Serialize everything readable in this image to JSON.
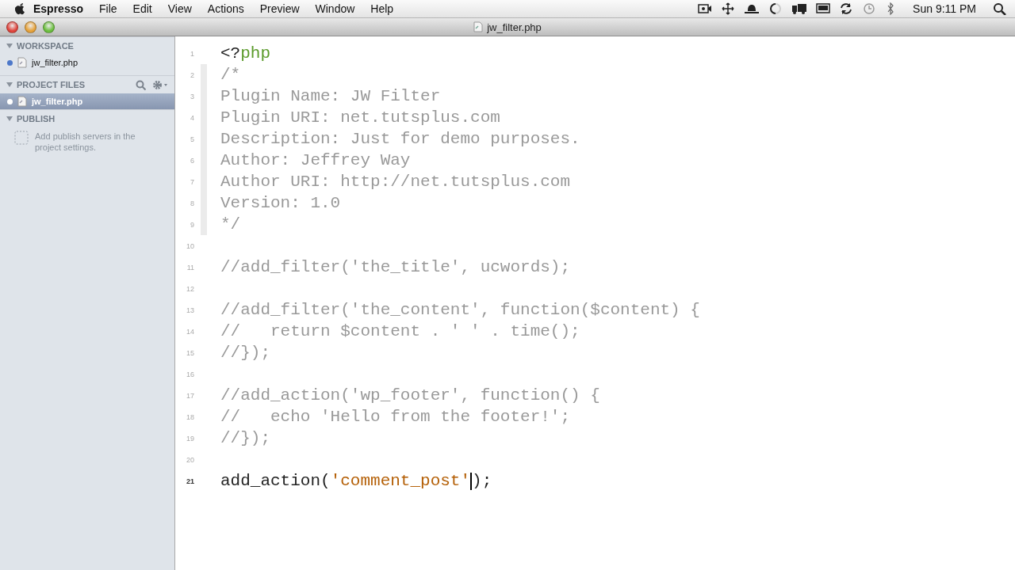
{
  "menu_bar": {
    "app_name": "Espresso",
    "menus": [
      "File",
      "Edit",
      "View",
      "Actions",
      "Preview",
      "Window",
      "Help"
    ],
    "clock": "Sun 9:11 PM"
  },
  "window": {
    "title": "jw_filter.php"
  },
  "sidebar": {
    "sections": [
      {
        "title": "WORKSPACE",
        "expanded": true,
        "items": [
          {
            "label": "jw_filter.php",
            "selected": false
          }
        ]
      },
      {
        "title": "PROJECT FILES",
        "expanded": true,
        "tools": true,
        "items": [
          {
            "label": "jw_filter.php",
            "selected": true
          }
        ]
      },
      {
        "title": "PUBLISH",
        "expanded": true,
        "hint": "Add publish servers in the project settings."
      }
    ]
  },
  "editor": {
    "lines": [
      {
        "number": "1",
        "current": false,
        "tokens": [
          {
            "text": "<?",
            "kind": "plain"
          },
          {
            "text": "php",
            "kind": "keyword"
          }
        ]
      },
      {
        "number": "2",
        "current": false,
        "tokens": [
          {
            "text": "/*",
            "kind": "comment"
          }
        ]
      },
      {
        "number": "3",
        "current": false,
        "tokens": [
          {
            "text": "Plugin Name: JW Filter",
            "kind": "comment"
          }
        ]
      },
      {
        "number": "4",
        "current": false,
        "tokens": [
          {
            "text": "Plugin URI: net.tutsplus.com",
            "kind": "comment"
          }
        ]
      },
      {
        "number": "5",
        "current": false,
        "tokens": [
          {
            "text": "Description: Just for demo purposes.",
            "kind": "comment"
          }
        ]
      },
      {
        "number": "6",
        "current": false,
        "tokens": [
          {
            "text": "Author: Jeffrey Way",
            "kind": "comment"
          }
        ]
      },
      {
        "number": "7",
        "current": false,
        "tokens": [
          {
            "text": "Author URI: http://net.tutsplus.com",
            "kind": "comment"
          }
        ]
      },
      {
        "number": "8",
        "current": false,
        "tokens": [
          {
            "text": "Version: 1.0",
            "kind": "comment"
          }
        ]
      },
      {
        "number": "9",
        "current": false,
        "tokens": [
          {
            "text": "*/",
            "kind": "comment"
          }
        ]
      },
      {
        "number": "10",
        "current": false
      },
      {
        "number": "11",
        "current": false,
        "tokens": [
          {
            "text": "//add_filter('the_title', ucwords);",
            "kind": "comment"
          }
        ]
      },
      {
        "number": "12",
        "current": false
      },
      {
        "number": "13",
        "current": false,
        "tokens": [
          {
            "text": "//add_filter('the_content', function($content) {",
            "kind": "comment"
          }
        ]
      },
      {
        "number": "14",
        "current": false,
        "tokens": [
          {
            "text": "//   return $content . ' ' . time();",
            "kind": "comment"
          }
        ]
      },
      {
        "number": "15",
        "current": false,
        "tokens": [
          {
            "text": "//});",
            "kind": "comment"
          }
        ]
      },
      {
        "number": "16",
        "current": false
      },
      {
        "number": "17",
        "current": false,
        "tokens": [
          {
            "text": "//add_action('wp_footer', function() {",
            "kind": "comment"
          }
        ]
      },
      {
        "number": "18",
        "current": false,
        "tokens": [
          {
            "text": "//   echo 'Hello from the footer!';",
            "kind": "comment"
          }
        ]
      },
      {
        "number": "19",
        "current": false,
        "tokens": [
          {
            "text": "//});",
            "kind": "comment"
          }
        ]
      },
      {
        "number": "20",
        "current": false
      },
      {
        "number": "21",
        "current": true,
        "tokens": [
          {
            "text": "add_action(",
            "kind": "plain"
          },
          {
            "text": "'comment_post'",
            "kind": "string"
          },
          {
            "kind": "cursor"
          },
          {
            "text": ");",
            "kind": "plain"
          }
        ]
      }
    ]
  }
}
